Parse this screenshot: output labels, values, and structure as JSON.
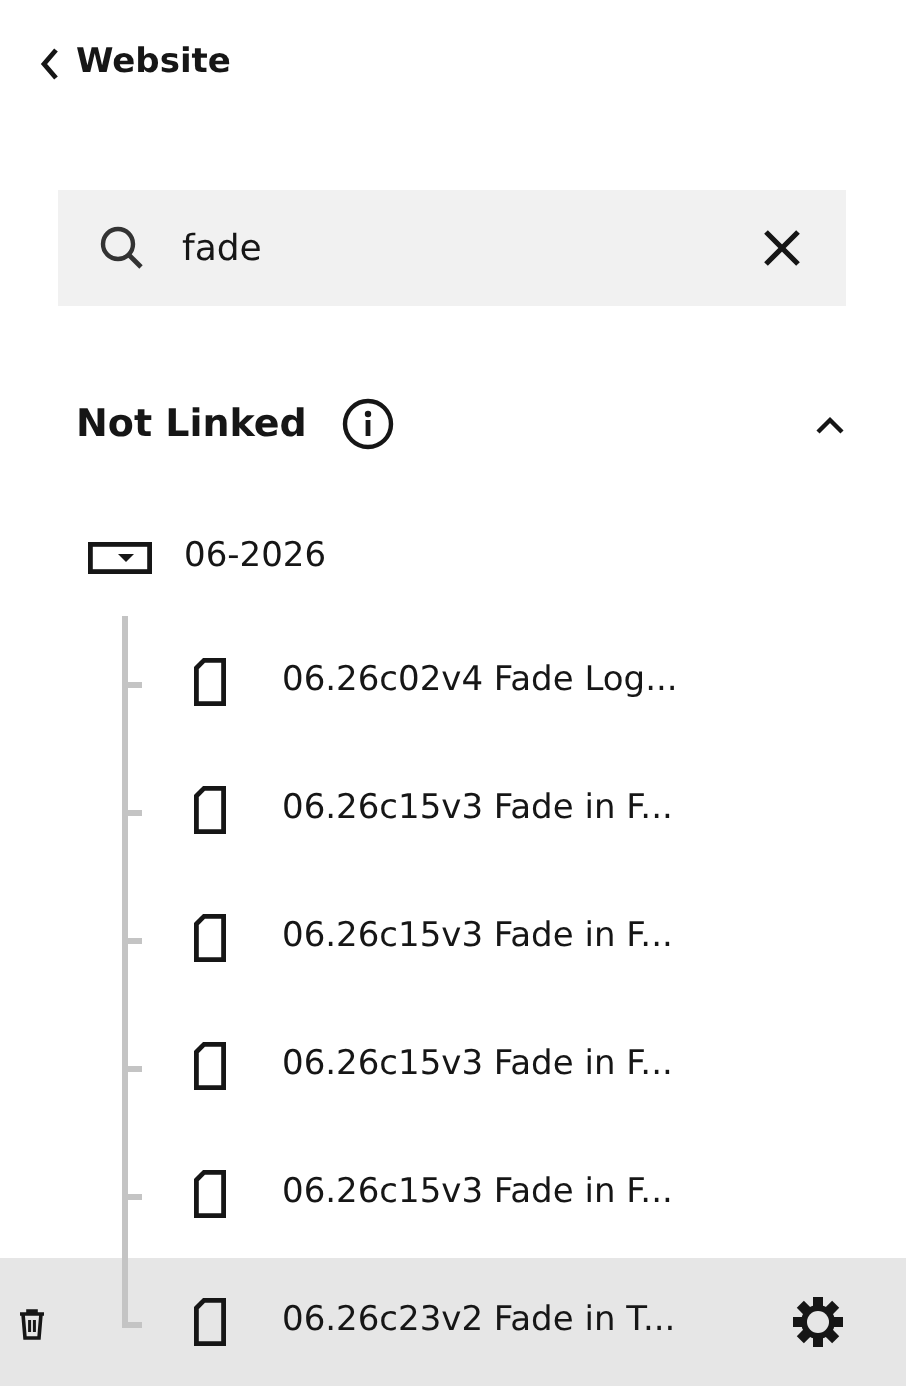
{
  "back_link": {
    "label": "Website"
  },
  "search": {
    "value": "fade"
  },
  "section": {
    "title": "Not Linked",
    "expanded": true,
    "folders": [
      {
        "label": "06-2026",
        "expanded": true,
        "children": [
          {
            "label": "06.26c02v4 Fade Log...",
            "selected": false
          },
          {
            "label": "06.26c15v3 Fade in F...",
            "selected": false
          },
          {
            "label": "06.26c15v3 Fade in F...",
            "selected": false
          },
          {
            "label": "06.26c15v3 Fade in F...",
            "selected": false
          },
          {
            "label": "06.26c15v3 Fade in F...",
            "selected": false
          },
          {
            "label": "06.26c23v2 Fade in T...",
            "selected": true
          }
        ]
      }
    ]
  }
}
